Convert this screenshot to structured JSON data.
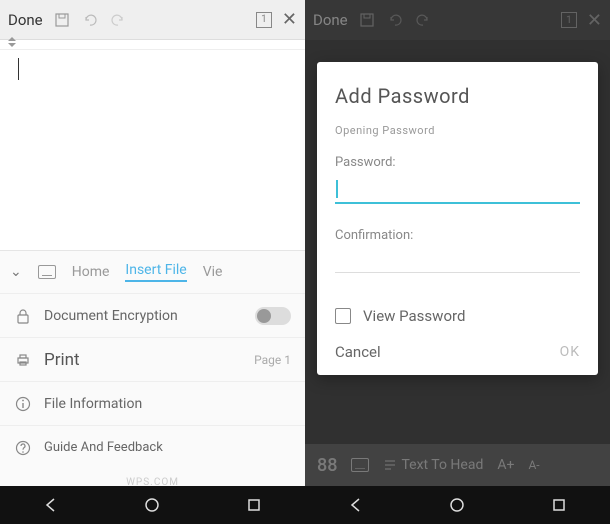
{
  "left": {
    "done": "Done",
    "page_number": "1",
    "tabs": {
      "home": "Home",
      "insert": "Insert File",
      "view": "Vie"
    },
    "rows": {
      "encryption": "Document Encryption",
      "print": "Print",
      "print_page": "Page 1",
      "info": "File Information",
      "guide": "Guide And Feedback"
    },
    "footer": "WPS.COM"
  },
  "right": {
    "done": "Done",
    "page_number": "1",
    "modal": {
      "title": "Add Password",
      "section": "Opening Password",
      "password_label": "Password:",
      "confirmation_label": "Confirmation:",
      "view_password": "View Password",
      "cancel": "Cancel",
      "ok": "OK"
    },
    "strip": {
      "num": "88",
      "text_to_head": "Text To Head",
      "a_plus": "A+",
      "a_minus": "A-"
    }
  }
}
